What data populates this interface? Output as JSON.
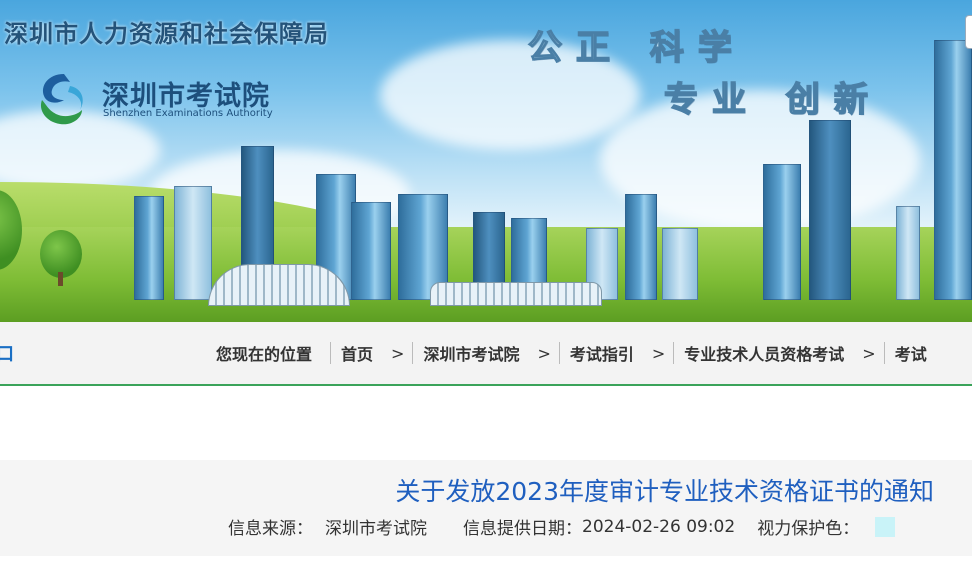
{
  "banner": {
    "org_name": "深圳市人力资源和社会保障局",
    "logo_cn": "深圳市考试院",
    "logo_en": "Shenzhen Examinations Authority",
    "motto_1": "公正  科学",
    "motto_2": "专业  创新"
  },
  "breadcrumb": {
    "left_fragment": "口",
    "label": "您现在的位置",
    "separator": ">",
    "items": [
      "首页",
      "深圳市考试院",
      "考试指引",
      "专业技术人员资格考试",
      "考试"
    ]
  },
  "article": {
    "title": "关于发放2023年度审计专业技术资格证书的通知",
    "source_label": "信息来源：",
    "source_value": "深圳市考试院",
    "date_label": "信息提供日期：",
    "date_value": "2024-02-26 09:02",
    "eye_care_label": "视力保护色：",
    "eye_care_color": "#c9f3f8"
  },
  "colors": {
    "accent_green": "#3aa35a",
    "title_blue": "#1f5fbf"
  }
}
